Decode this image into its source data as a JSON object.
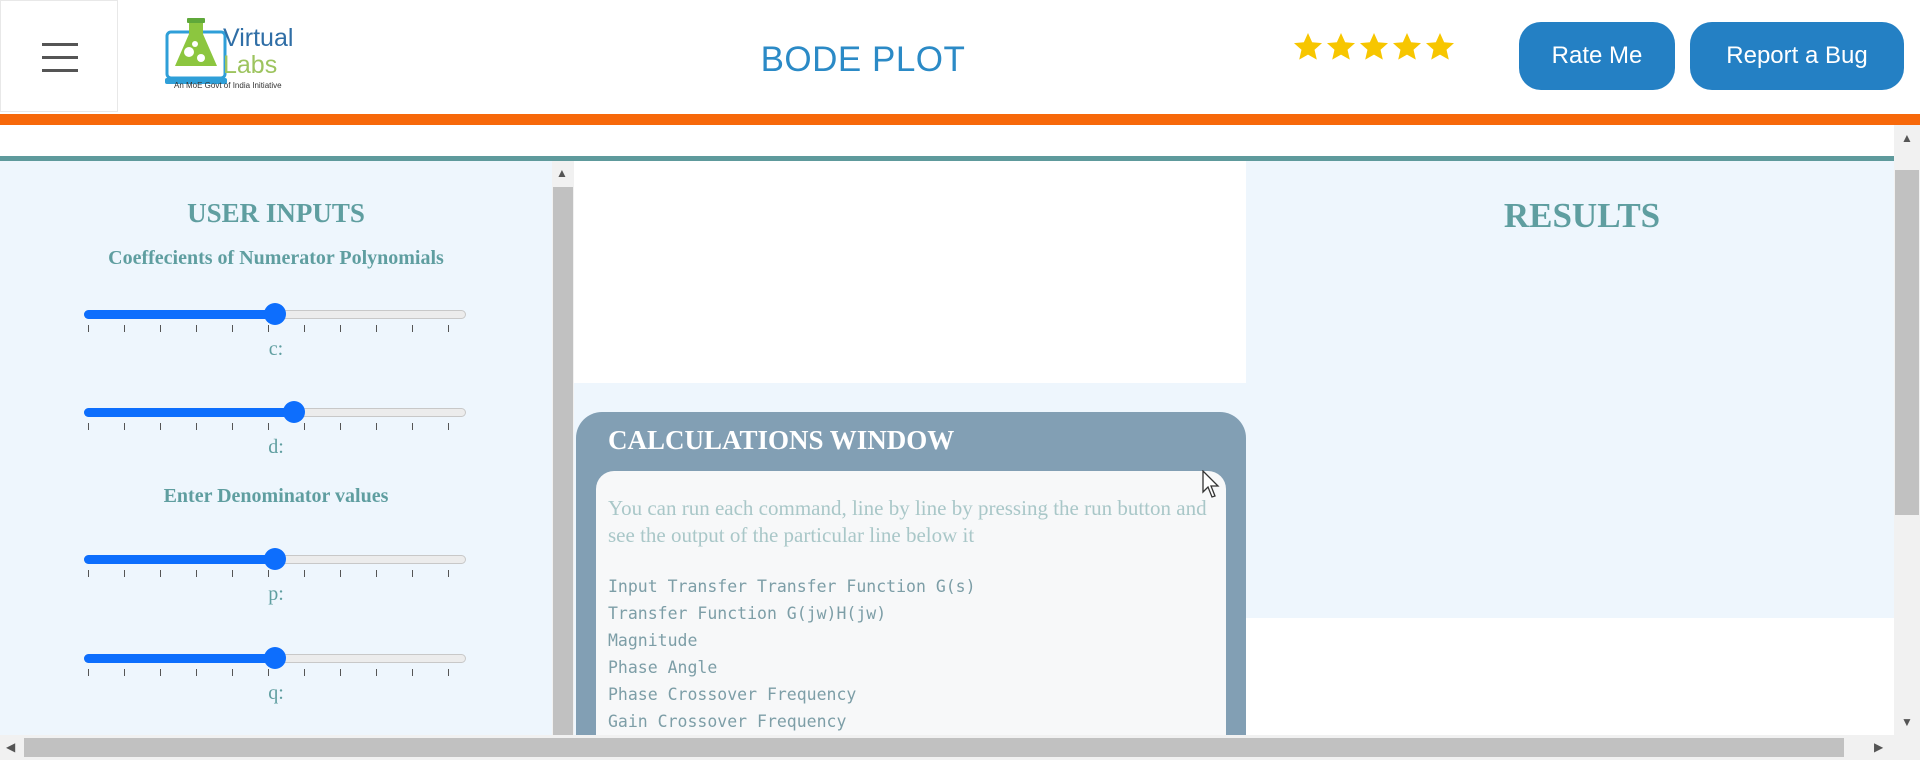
{
  "header": {
    "title": "BODE PLOT",
    "logo": {
      "line1": "Virtual",
      "line2": "Labs",
      "tagline": "An MoE Govt of India Initiative"
    },
    "rating_stars": 5,
    "rate_button": "Rate Me",
    "report_button": "Report a Bug"
  },
  "colors": {
    "brand_blue": "#2480c4",
    "accent_orange": "#f7680a",
    "teal": "#5f9ea0",
    "star_yellow": "#f7c600",
    "slider_blue": "#0d6efd"
  },
  "user_inputs": {
    "title": "USER INPUTS",
    "numerator_heading": "Coeffecients of Numerator Polynomials",
    "denominator_heading": "Enter Denominator values",
    "sliders": [
      {
        "label": "c:",
        "value_fraction": 0.5
      },
      {
        "label": "d:",
        "value_fraction": 0.55
      },
      {
        "label": "p:",
        "value_fraction": 0.5
      },
      {
        "label": "q:",
        "value_fraction": 0.5
      }
    ]
  },
  "calculations": {
    "title": "CALCULATIONS WINDOW",
    "hint": "You can run each command, line by line by pressing the run button and see the output of the particular line below it",
    "lines": [
      "Input Transfer Transfer Function G(s)",
      "Transfer Function G(jw)H(jw)",
      "Magnitude",
      "Phase Angle",
      "Phase Crossover Frequency",
      "Gain Crossover Frequency"
    ]
  },
  "results": {
    "title": "RESULTS"
  },
  "icons": {
    "menu": "hamburger-icon",
    "star": "star-icon",
    "cursor": "mouse-pointer-icon"
  }
}
